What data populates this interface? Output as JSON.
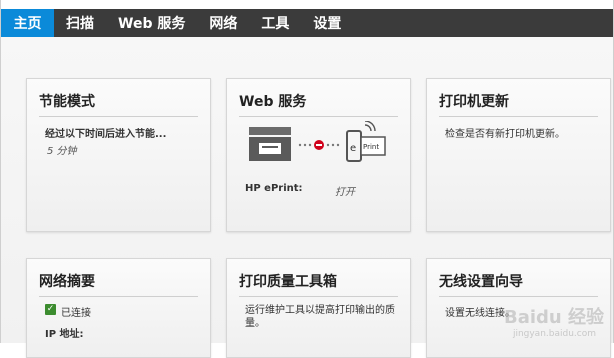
{
  "nav": {
    "items": [
      {
        "label": "主页",
        "active": true
      },
      {
        "label": "扫描",
        "active": false
      },
      {
        "label": "Web 服务",
        "active": false
      },
      {
        "label": "网络",
        "active": false
      },
      {
        "label": "工具",
        "active": false
      },
      {
        "label": "设置",
        "active": false
      }
    ]
  },
  "cards": {
    "power_save": {
      "title": "节能模式",
      "desc": "经过以下时间后进入节能...",
      "value": "5 分钟"
    },
    "web_services": {
      "title": "Web 服务",
      "eprint_label": "HP ePrint:",
      "eprint_value": "打开",
      "icon_text": "Print"
    },
    "printer_update": {
      "title": "打印机更新",
      "desc": "检查是否有新打印机更新。"
    },
    "network_summary": {
      "title": "网络摘要",
      "status": "已连接",
      "ip_label": "IP 地址:"
    },
    "print_quality": {
      "title": "打印质量工具箱",
      "desc": "运行维护工具以提高打印输出的质量。"
    },
    "wireless_wizard": {
      "title": "无线设置向导",
      "desc": "设置无线连接。"
    }
  },
  "colors": {
    "nav_bg": "#3b3b3b",
    "nav_active": "#0b8ad9",
    "status_ok": "#3c8c2f",
    "error_red": "#d0021b"
  },
  "watermark": {
    "text": "Baidu 经验",
    "sub": "jingyan.baidu.com"
  }
}
